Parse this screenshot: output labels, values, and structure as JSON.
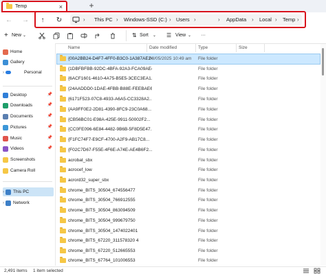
{
  "window": {
    "tab_title": "Temp",
    "tab_close": "×",
    "new_tab": "+"
  },
  "address": {
    "crumbs": [
      "This PC",
      "Windows-SSD (C:)",
      "Users",
      "AppData",
      "Local",
      "Temp"
    ],
    "separator": "›"
  },
  "toolbar": {
    "new_label": "New",
    "sort_label": "Sort",
    "view_label": "View",
    "more_label": "···"
  },
  "sidebar": {
    "items": [
      {
        "label": "Home",
        "icon": "home-icon",
        "color": "#e46a4e"
      },
      {
        "label": "Gallery",
        "icon": "gallery-icon",
        "color": "#3b8fd6"
      },
      {
        "label": "Personal",
        "icon": "onedrive-icon",
        "color": "#2a7de1"
      },
      {
        "label": "Desktop",
        "icon": "desktop-icon",
        "color": "#2f7fd8"
      },
      {
        "label": "Downloads",
        "icon": "downloads-icon",
        "color": "#1e9e6a"
      },
      {
        "label": "Documents",
        "icon": "documents-icon",
        "color": "#5a7fb0"
      },
      {
        "label": "Pictures",
        "icon": "pictures-icon",
        "color": "#3c97d8"
      },
      {
        "label": "Music",
        "icon": "music-icon",
        "color": "#e0544c"
      },
      {
        "label": "Videos",
        "icon": "videos-icon",
        "color": "#8a55c7"
      },
      {
        "label": "Screenshots",
        "icon": "folder-icon",
        "color": "#f6c745"
      },
      {
        "label": "Camera Roll",
        "icon": "folder-icon",
        "color": "#f6c745"
      },
      {
        "label": "This PC",
        "icon": "this-pc-icon",
        "color": "#3d7fc7"
      },
      {
        "label": "Network",
        "icon": "network-icon",
        "color": "#3d7fc7"
      }
    ]
  },
  "columns": {
    "name": "Name",
    "date": "Date modified",
    "type": "Type",
    "size": "Size"
  },
  "files": [
    {
      "name": "{00A2BB24-D4F7-4FF0-B3C0-1A387AE24...",
      "date": "08/05/2025 10:49 am",
      "type": "File folder"
    },
    {
      "name": "{1DBFBFBB-92DC-4BFA-92A3-FCA09AE4...",
      "date": "",
      "type": "File folder"
    },
    {
      "name": "{6ACF1601-4610-4A75-B5E5-3CEC3EA1...",
      "date": "",
      "type": "File folder"
    },
    {
      "name": "{24AADDD0-1DAE-4FBB-B88E-FEEBAE6...",
      "date": "",
      "type": "File folder"
    },
    {
      "name": "{6171F523-07C8-4933-A6A5-CC3328A2...",
      "date": "",
      "type": "File folder"
    },
    {
      "name": "{AA9FF0E2-2D81-4390-8FC9-23C0A68...",
      "date": "",
      "type": "File folder"
    },
    {
      "name": "{CB56BC01-E98A-425E-9911-50002F2...",
      "date": "",
      "type": "File folder"
    },
    {
      "name": "{CC0FE096-6E84-4482-9B6B-5F8D5E47...",
      "date": "",
      "type": "File folder"
    },
    {
      "name": "{F1FC74F7-E9CF-4700-A2F9-AB17C8...",
      "date": "",
      "type": "File folder"
    },
    {
      "name": "{F02C7D67-F55E-4F6E-A74E-AE4B6F2...",
      "date": "",
      "type": "File folder"
    },
    {
      "name": "acrobat_sbx",
      "date": "",
      "type": "File folder"
    },
    {
      "name": "acrocef_low",
      "date": "",
      "type": "File folder"
    },
    {
      "name": "acrord32_super_sbx",
      "date": "",
      "type": "File folder"
    },
    {
      "name": "chrome_BITS_30504_674556477",
      "date": "",
      "type": "File folder"
    },
    {
      "name": "chrome_BITS_30504_766912555",
      "date": "",
      "type": "File folder"
    },
    {
      "name": "chrome_BITS_30504_863094509",
      "date": "",
      "type": "File folder"
    },
    {
      "name": "chrome_BITS_30504_999679750",
      "date": "",
      "type": "File folder"
    },
    {
      "name": "chrome_BITS_30504_1474022401",
      "date": "",
      "type": "File folder"
    },
    {
      "name": "chrome_BITS_67220_311578320 4",
      "date": "",
      "type": "File folder"
    },
    {
      "name": "chrome_BITS_67220_512665553",
      "date": "",
      "type": "File folder"
    },
    {
      "name": "chrome_BITS_67764_101006553",
      "date": "",
      "type": "File folder"
    }
  ],
  "status": {
    "count": "2,491 items",
    "selected": "1 item selected"
  }
}
